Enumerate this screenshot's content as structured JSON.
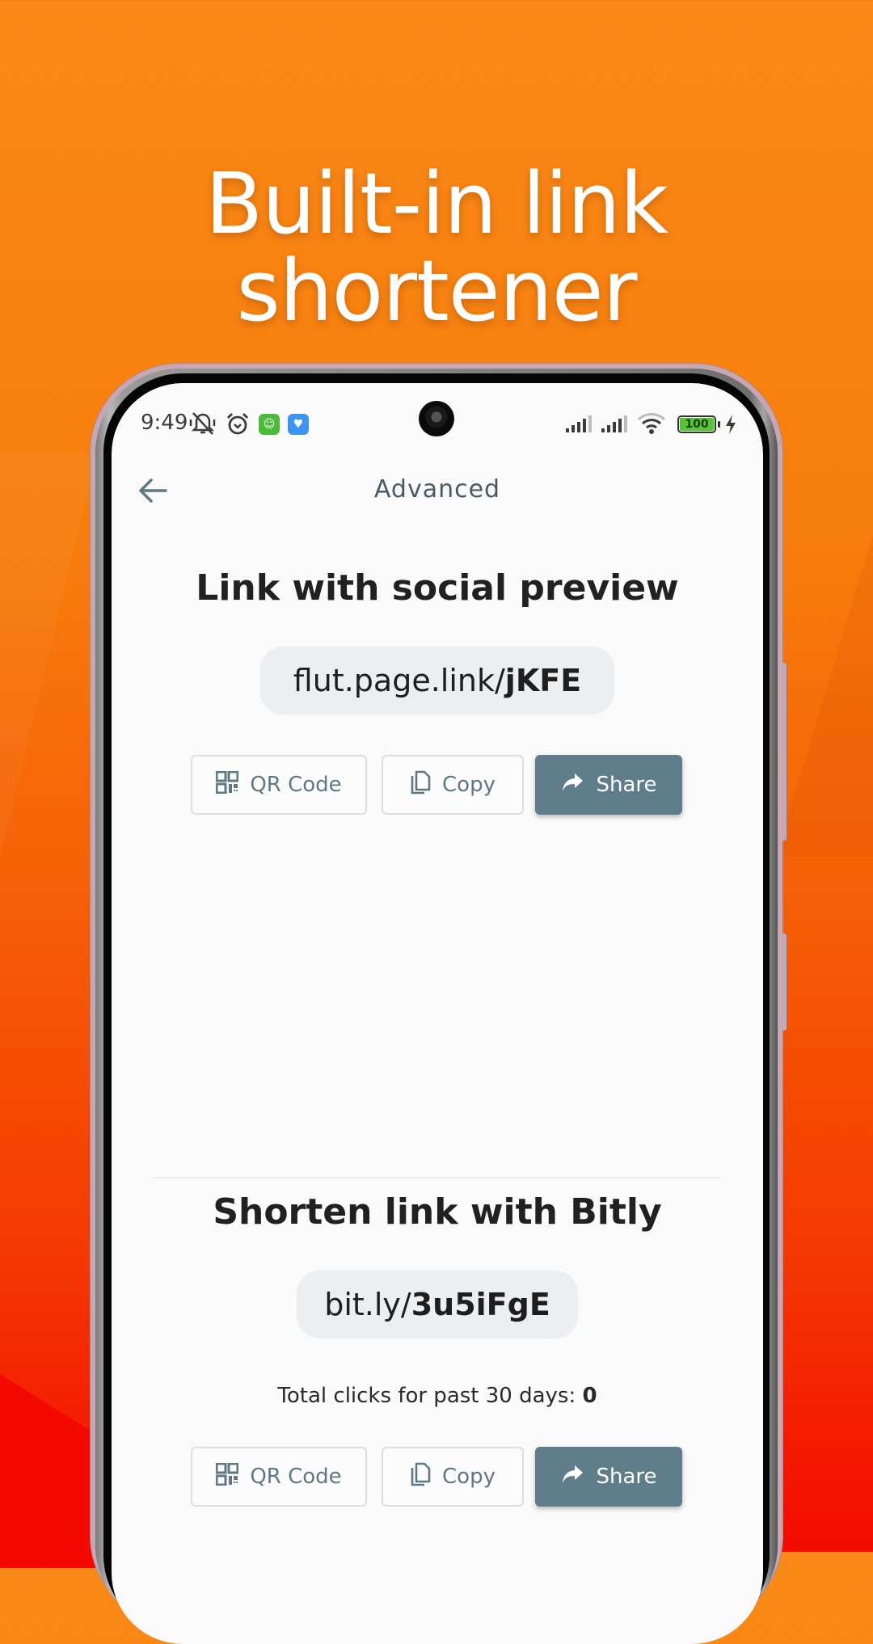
{
  "promo": {
    "headline_line1": "Built-in link",
    "headline_line2": "shortener",
    "background_colors": [
      "#f98a18",
      "#f65c05",
      "#f40a00"
    ]
  },
  "status_bar": {
    "time": "9:49",
    "icons": [
      "vibrate-muted-icon",
      "alarm-icon",
      "app-notification-green-icon",
      "app-notification-blue-icon"
    ],
    "right_icons": [
      "signal-sim1-icon",
      "signal-sim2-icon",
      "wifi-icon",
      "battery-icon",
      "charging-icon"
    ],
    "battery_level": "100",
    "battery_color": "#55c534"
  },
  "app_bar": {
    "title": "Advanced",
    "back_icon": "arrow-left-icon"
  },
  "social_preview": {
    "title": "Link with social preview",
    "link_prefix": "flut.page.link/",
    "link_code": "jKFE",
    "buttons": {
      "qr": "QR Code",
      "copy": "Copy",
      "share": "Share"
    }
  },
  "bitly": {
    "title": "Shorten link with Bitly",
    "link_prefix": "bit.ly/",
    "link_code": "3u5iFgE",
    "clicks_label": "Total clicks for past 30 days: ",
    "clicks_value": "0",
    "buttons": {
      "qr": "QR Code",
      "copy": "Copy",
      "share": "Share"
    }
  },
  "colors": {
    "primary_button": "#607d8b",
    "outlined_text": "#5f7886",
    "chip_bg": "#eceff1"
  }
}
